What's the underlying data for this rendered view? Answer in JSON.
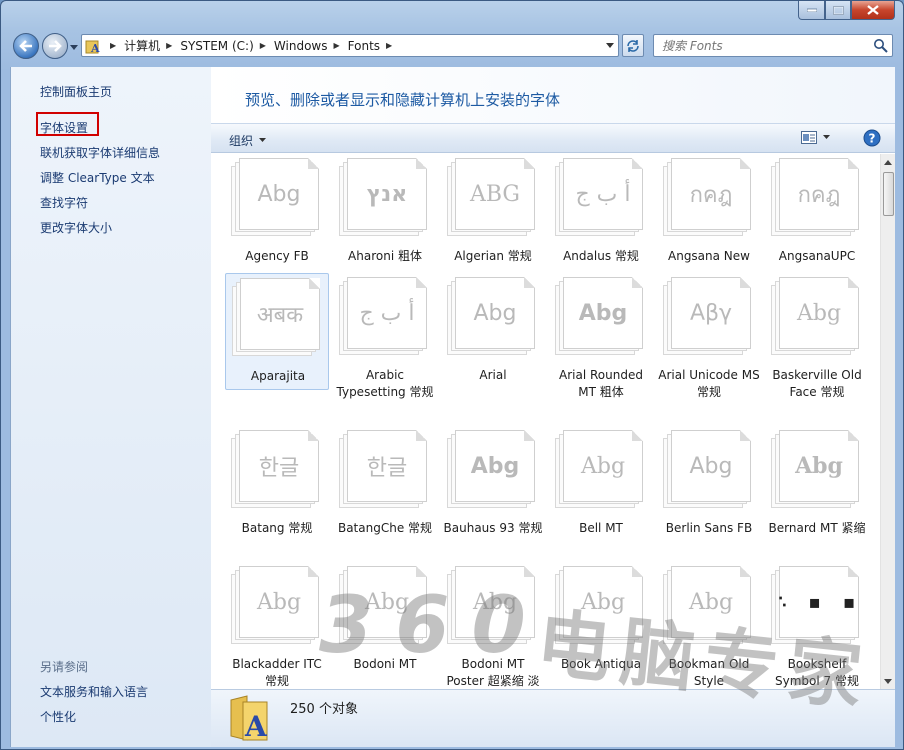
{
  "window": {
    "caption_min": "—",
    "caption_close": "✕"
  },
  "address": {
    "crumbs": [
      "计算机",
      "SYSTEM (C:)",
      "Windows",
      "Fonts"
    ]
  },
  "search": {
    "placeholder": "搜索 Fonts"
  },
  "taskpane": {
    "links": [
      "控制面板主页",
      "字体设置",
      "联机获取字体详细信息",
      "调整 ClearType 文本",
      "查找字符",
      "更改字体大小"
    ],
    "see_also_heading": "另请参阅",
    "see_also_links": [
      "文本服务和输入语言",
      "个性化"
    ]
  },
  "content": {
    "title": "预览、删除或者显示和隐藏计算机上安装的字体",
    "toolbar": {
      "organize": "组织"
    }
  },
  "fonts": [
    {
      "name": "Agency FB",
      "sample": "Abg",
      "style": "sans"
    },
    {
      "name": "Aharoni 粗体",
      "sample": "אנץ",
      "style": "sans bold"
    },
    {
      "name": "Algerian 常规",
      "sample": "ABG",
      "style": "serif"
    },
    {
      "name": "Andalus 常规",
      "sample": "أ ب ج",
      "style": "serif"
    },
    {
      "name": "Angsana New",
      "sample": "กคฎ",
      "style": "serif"
    },
    {
      "name": "AngsanaUPC",
      "sample": "กคฎ",
      "style": "serif"
    },
    {
      "name": "Aparajita",
      "sample": "अबक",
      "style": "serif"
    },
    {
      "name": "Arabic Typesetting 常规",
      "sample": "أ ب ج",
      "style": "serif"
    },
    {
      "name": "Arial",
      "sample": "Abg",
      "style": "sans"
    },
    {
      "name": "Arial Rounded MT 粗体",
      "sample": "Abg",
      "style": "sans bold"
    },
    {
      "name": "Arial Unicode MS 常规",
      "sample": "Αβγ",
      "style": "sans"
    },
    {
      "name": "Baskerville Old Face 常规",
      "sample": "Abg",
      "style": "serif"
    },
    {
      "name": "Batang 常规",
      "sample": "한글",
      "style": "serif"
    },
    {
      "name": "BatangChe 常规",
      "sample": "한글",
      "style": "serif"
    },
    {
      "name": "Bauhaus 93 常规",
      "sample": "Abg",
      "style": "sans bold"
    },
    {
      "name": "Bell MT",
      "sample": "Abg",
      "style": "serif"
    },
    {
      "name": "Berlin Sans FB",
      "sample": "Abg",
      "style": "sans"
    },
    {
      "name": "Bernard MT 紧缩",
      "sample": "Abg",
      "style": "serif bold"
    },
    {
      "name": "Blackadder ITC 常规",
      "sample": "Abg",
      "style": "serif"
    },
    {
      "name": "Bodoni MT",
      "sample": "Abg",
      "style": "serif"
    },
    {
      "name": "Bodoni MT Poster 超紧缩 淡",
      "sample": "Abg",
      "style": "serif"
    },
    {
      "name": "Book Antiqua",
      "sample": "Abg",
      "style": "serif"
    },
    {
      "name": "Bookman Old Style",
      "sample": "Abg",
      "style": "serif"
    },
    {
      "name": "Bookshelf Symbol 7 常规",
      "sample": "∴ ▪ ▪",
      "style": "bookshelf"
    }
  ],
  "status": {
    "count": "250 个对象"
  },
  "watermark": {
    "number": "360",
    "text": "电脑专家"
  }
}
